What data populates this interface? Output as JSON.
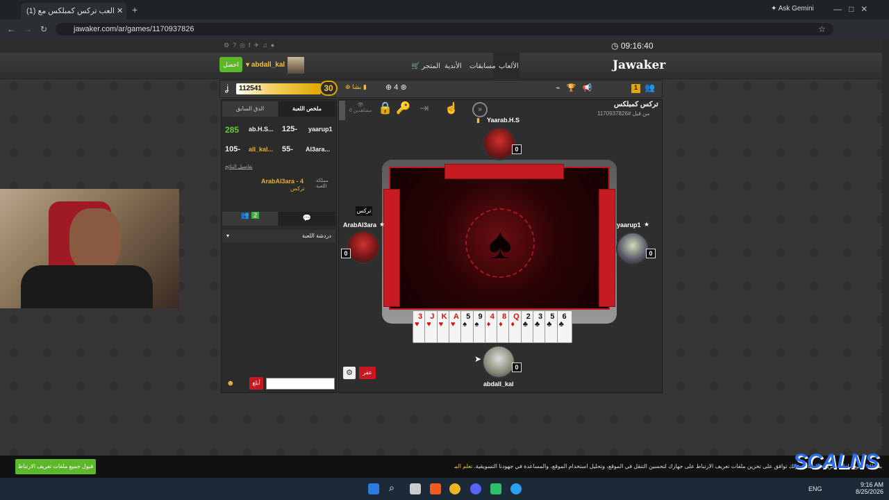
{
  "browser": {
    "tab_title": "(1) العب تركس كمبلكس مع",
    "new_tab": "+",
    "ask_gemini": "Ask Gemini",
    "url": "jawaker.com/ar/games/1170937826"
  },
  "site": {
    "clock": "09:16:40",
    "logo": "Jawaker",
    "nav": {
      "games": "الألعاب",
      "competitions": "مسابقات",
      "clubs": "الأندية",
      "store": "المتجر"
    },
    "get_button": "احصل",
    "username": "abdall_kal",
    "xp_value": "112541",
    "level": "30",
    "coins_label": "بشا",
    "count_4": "4",
    "badge_1": "1"
  },
  "left_panel": {
    "tab_summary": "ملخص اللعبة",
    "tab_previous": "الدق السابق",
    "scores": [
      {
        "player_a": "yaarup1",
        "score_a": "125-",
        "player_b": "ab.H.S...",
        "score_b": "285"
      },
      {
        "player_a": "Al3ara...",
        "score_a": "55-",
        "player_b": "all_kal...",
        "score_b": "105-"
      }
    ],
    "details_link": "تفاصيل النتائج",
    "kingdom_label": "مملكة اللعبة",
    "kingdom_value": "ArabAl3ara - 4",
    "kingdom_sub": "تركس",
    "friends_count": "2",
    "chat_header": "دردشة اللعبة",
    "send_button": "أبلغ"
  },
  "game": {
    "title": "تركس كمبلكس",
    "game_id": "#1170937826",
    "time_ago": "من قبل",
    "spectators": "0 مشاهدين",
    "players": {
      "top": {
        "name": "Yaarab.H.S",
        "score": "0"
      },
      "left": {
        "name": "ArabAl3ara",
        "score": "0",
        "badge": "تركس"
      },
      "right": {
        "name": "yaarup1",
        "score": "0"
      },
      "bottom": {
        "name": "abdall_kal",
        "score": "0"
      }
    },
    "hand": [
      {
        "rank": "3",
        "suit": "♥",
        "color": "red"
      },
      {
        "rank": "J",
        "suit": "♥",
        "color": "red"
      },
      {
        "rank": "K",
        "suit": "♥",
        "color": "red"
      },
      {
        "rank": "A",
        "suit": "♥",
        "color": "red"
      },
      {
        "rank": "5",
        "suit": "♠",
        "color": "blk"
      },
      {
        "rank": "9",
        "suit": "♠",
        "color": "blk"
      },
      {
        "rank": "4",
        "suit": "♦",
        "color": "red"
      },
      {
        "rank": "8",
        "suit": "♦",
        "color": "red"
      },
      {
        "rank": "Q",
        "suit": "♦",
        "color": "red"
      },
      {
        "rank": "2",
        "suit": "♣",
        "color": "blk"
      },
      {
        "rank": "3",
        "suit": "♣",
        "color": "blk"
      },
      {
        "rank": "5",
        "suit": "♣",
        "color": "blk"
      },
      {
        "rank": "6",
        "suit": "♣",
        "color": "blk"
      }
    ],
    "pass_button": "عفر"
  },
  "cookie": {
    "text": "بقبولك جميع ملفات تعريف الارتباط، فإنك توافق على تخزين ملفات تعريف الارتباط على جهازك لتحسين التنقل في الموقع، وتحليل استخدام الموقع، والمساعدة في جهودنا التسويقية.",
    "more": "تعلم المزيد",
    "accept": "قبول جميع ملفات تعريف الارتباط"
  },
  "watermark": "SCALNS",
  "taskbar": {
    "lang": "ENG",
    "time": "9:16 AM",
    "date": "8/25/2026"
  }
}
